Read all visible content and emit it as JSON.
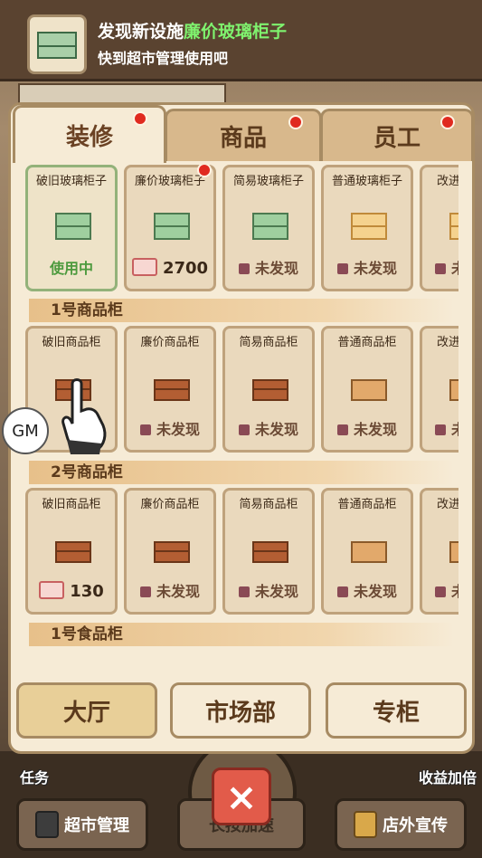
{
  "notification": {
    "title_prefix": "发现新设施",
    "title_highlight": "廉价玻璃柜子",
    "subtitle": "快到超市管理使用吧"
  },
  "tabs": [
    {
      "label": "装修",
      "active": true,
      "dot": true
    },
    {
      "label": "商品",
      "active": false,
      "dot": true
    },
    {
      "label": "员工",
      "active": false,
      "dot": true
    }
  ],
  "glass_row": [
    {
      "name": "破旧玻璃柜子",
      "status": "使用中"
    },
    {
      "name": "廉价玻璃柜子",
      "status": "2700"
    },
    {
      "name": "简易玻璃柜子",
      "status": "未发现"
    },
    {
      "name": "普通玻璃柜子",
      "status": "未发现"
    },
    {
      "name": "改进玻",
      "status": "未"
    }
  ],
  "sections": {
    "s1": "1号商品柜",
    "s2": "2号商品柜",
    "s3": "1号食品柜"
  },
  "shelf1_row": [
    {
      "name": "破旧商品柜",
      "status": ""
    },
    {
      "name": "廉价商品柜",
      "status": "未发现"
    },
    {
      "name": "简易商品柜",
      "status": "未发现"
    },
    {
      "name": "普通商品柜",
      "status": "未发现"
    },
    {
      "name": "改进",
      "status": "未"
    }
  ],
  "shelf2_row": [
    {
      "name": "破旧商品柜",
      "status": "130"
    },
    {
      "name": "廉价商品柜",
      "status": "未发现"
    },
    {
      "name": "简易商品柜",
      "status": "未发现"
    },
    {
      "name": "普通商品柜",
      "status": "未发现"
    },
    {
      "name": "改进",
      "status": "未"
    }
  ],
  "bottom_tabs": [
    "大厅",
    "市场部",
    "专柜"
  ],
  "gm_label": "GM",
  "background": {
    "task": "任务",
    "income": "收益加倍",
    "manage": "超市管理",
    "speed": "长按加速",
    "promo": "店外宣传"
  },
  "close_icon": "×"
}
